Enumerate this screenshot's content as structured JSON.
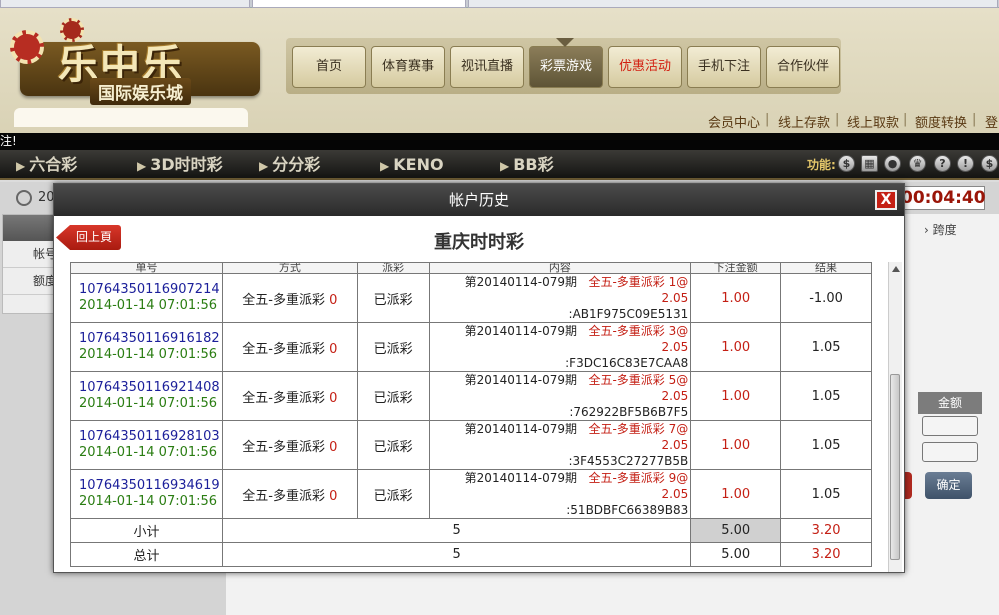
{
  "site": {
    "logo_main": "乐中乐",
    "logo_sub": "国际娱乐城",
    "nav": [
      "首页",
      "体育赛事",
      "视讯直播",
      "彩票游戏",
      "优惠活动",
      "手机下注",
      "合作伙伴"
    ],
    "toplinks": [
      "会员中心",
      "线上存款",
      "线上取款",
      "额度转换",
      "登"
    ],
    "ticker": "注!",
    "games": [
      "六合彩",
      "3D时时彩",
      "分分彩",
      "KENO",
      "BB彩"
    ],
    "func_label": "功能:",
    "clock_partial": "20",
    "timer": "00:04:40",
    "left_menu": [
      "帐号",
      "额度"
    ],
    "right_kd": "跨度",
    "amount_header": "金额",
    "confirm": "确定"
  },
  "modal": {
    "title": "帐户历史",
    "close": "X",
    "back": "回上頁",
    "heading": "重庆时时彩",
    "columns": [
      "单号",
      "方式",
      "派彩",
      "内容",
      "下注金额",
      "结果"
    ],
    "rows": [
      {
        "id": "10764350116907214",
        "time": "2014-01-14 07:01:56",
        "method": "全五-多重派彩",
        "method_num": "0",
        "status": "已派彩",
        "period": "第20140114-079期",
        "play": "全五-多重派彩 1@",
        "odds": "2.05",
        "code": ":AB1F975C09E5131",
        "amount": "1.00",
        "result": "-1.00"
      },
      {
        "id": "10764350116916182",
        "time": "2014-01-14 07:01:56",
        "method": "全五-多重派彩",
        "method_num": "0",
        "status": "已派彩",
        "period": "第20140114-079期",
        "play": "全五-多重派彩 3@",
        "odds": "2.05",
        "code": ":F3DC16C83E7CAA8",
        "amount": "1.00",
        "result": "1.05"
      },
      {
        "id": "10764350116921408",
        "time": "2014-01-14 07:01:56",
        "method": "全五-多重派彩",
        "method_num": "0",
        "status": "已派彩",
        "period": "第20140114-079期",
        "play": "全五-多重派彩 5@",
        "odds": "2.05",
        "code": ":762922BF5B6B7F5",
        "amount": "1.00",
        "result": "1.05"
      },
      {
        "id": "10764350116928103",
        "time": "2014-01-14 07:01:56",
        "method": "全五-多重派彩",
        "method_num": "0",
        "status": "已派彩",
        "period": "第20140114-079期",
        "play": "全五-多重派彩 7@",
        "odds": "2.05",
        "code": ":3F4553C27277B5B",
        "amount": "1.00",
        "result": "1.05"
      },
      {
        "id": "10764350116934619",
        "time": "2014-01-14 07:01:56",
        "method": "全五-多重派彩",
        "method_num": "0",
        "status": "已派彩",
        "period": "第20140114-079期",
        "play": "全五-多重派彩 9@",
        "odds": "2.05",
        "code": ":51BDBFC66389B83",
        "amount": "1.00",
        "result": "1.05"
      }
    ],
    "subtotal": {
      "label": "小计",
      "count": "5",
      "amount": "5.00",
      "result": "3.20"
    },
    "total": {
      "label": "总计",
      "count": "5",
      "amount": "5.00",
      "result": "3.20"
    }
  },
  "colors": {
    "accent_red": "#c41f14",
    "order_blue": "#1b1f9a",
    "time_green": "#2a7d12",
    "nav_active": "#5e5436"
  }
}
